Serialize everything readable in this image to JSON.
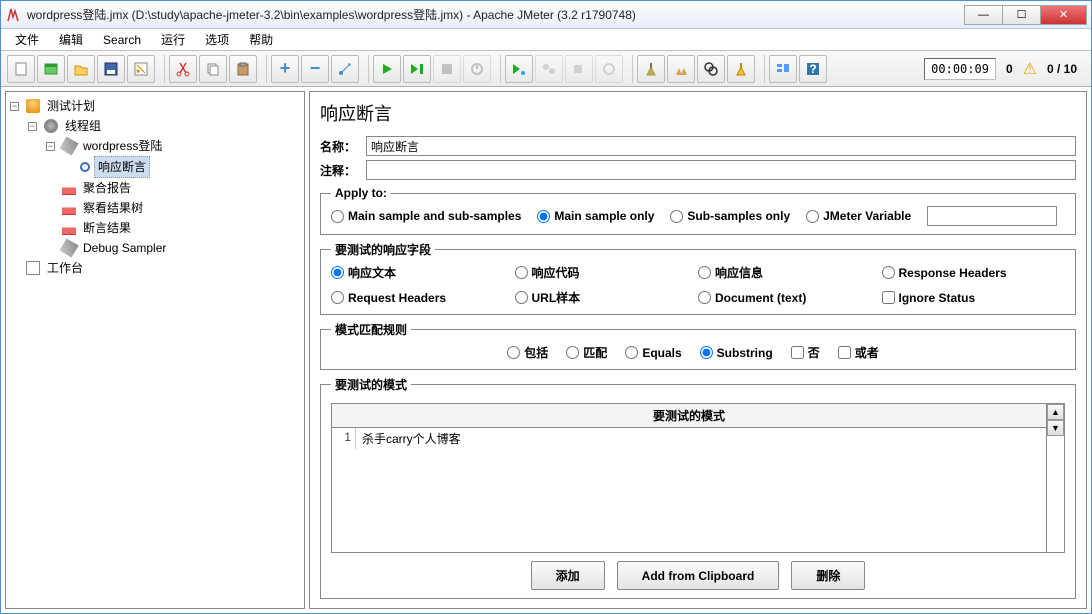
{
  "window": {
    "title": "wordpress登陆.jmx (D:\\study\\apache-jmeter-3.2\\bin\\examples\\wordpress登陆.jmx) - Apache JMeter (3.2 r1790748)"
  },
  "menu": [
    "文件",
    "编辑",
    "Search",
    "运行",
    "选项",
    "帮助"
  ],
  "toolbar": {
    "timer": "00:00:09",
    "warn_count": "0",
    "thread_counter": "0 / 10"
  },
  "tree": {
    "root": "测试计划",
    "thread_group": "线程组",
    "sampler": "wordpress登陆",
    "assertion": "响应断言",
    "aggregate": "聚合报告",
    "view_tree": "察看结果树",
    "assert_results": "断言结果",
    "debug": "Debug Sampler",
    "workbench": "工作台"
  },
  "editor": {
    "heading": "响应断言",
    "name_label": "名称：",
    "name_value": "响应断言",
    "comment_label": "注释：",
    "comment_value": "",
    "apply_legend": "Apply to:",
    "apply_opts": {
      "main_sub": "Main sample and sub-samples",
      "main": "Main sample only",
      "sub": "Sub-samples only",
      "var": "JMeter Variable"
    },
    "field_legend": "要测试的响应字段",
    "field_opts": {
      "text": "响应文本",
      "code": "响应代码",
      "msg": "响应信息",
      "resp_hdr": "Response Headers",
      "req_hdr": "Request Headers",
      "url": "URL样本",
      "doc": "Document (text)",
      "ignore": "Ignore Status"
    },
    "rule_legend": "模式匹配规则",
    "rule_opts": {
      "contains": "包括",
      "matches": "匹配",
      "equals": "Equals",
      "substring": "Substring",
      "not": "否",
      "or": "或者"
    },
    "patterns_legend": "要测试的模式",
    "patterns_header": "要测试的模式",
    "patterns": [
      {
        "idx": "1",
        "value": "杀手carry个人博客"
      }
    ],
    "buttons": {
      "add": "添加",
      "clipboard": "Add from Clipboard",
      "delete": "删除"
    }
  }
}
